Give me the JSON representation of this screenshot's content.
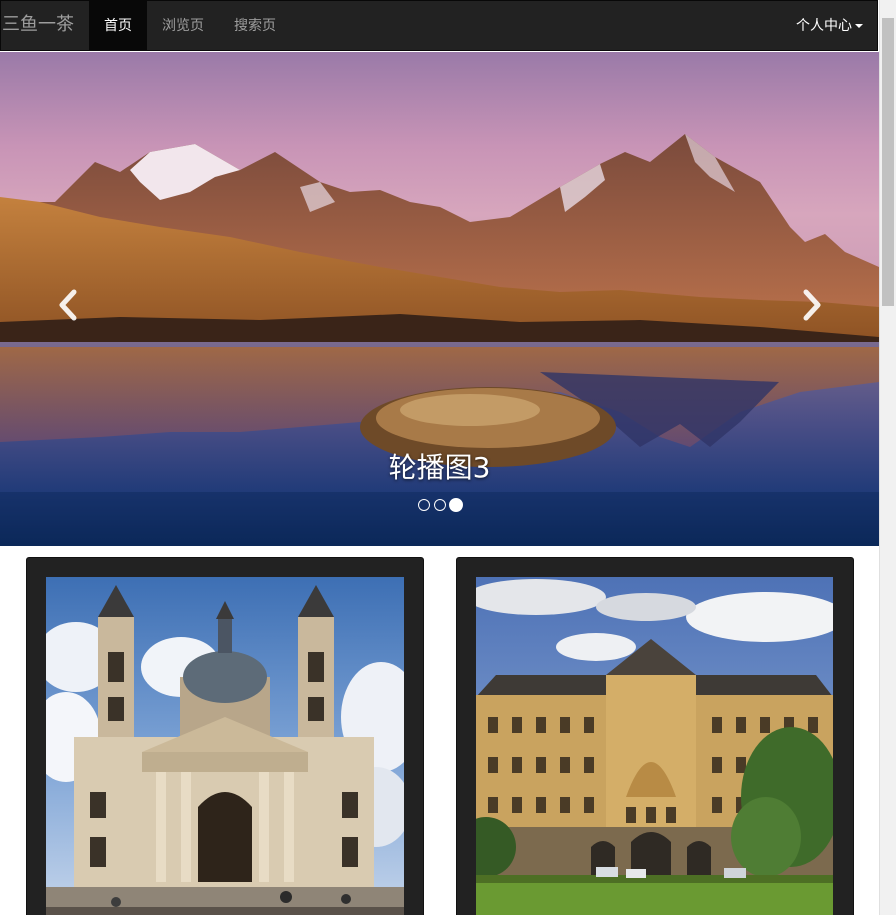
{
  "navbar": {
    "brand": "三鱼一茶",
    "items": [
      {
        "label": "首页",
        "active": true
      },
      {
        "label": "浏览页",
        "active": false
      },
      {
        "label": "搜索页",
        "active": false
      }
    ],
    "user_menu": "个人中心"
  },
  "carousel": {
    "caption": "轮播图3",
    "indicator_count": 3,
    "active_index": 2,
    "prev_icon": "chevron-left-icon",
    "next_icon": "chevron-right-icon"
  },
  "gallery": {
    "cards": [
      {
        "image": "basilica-photo"
      },
      {
        "image": "palace-photo"
      }
    ]
  },
  "colors": {
    "navbar_bg": "#222222",
    "nav_active_bg": "#080808",
    "nav_text": "#9d9d9d",
    "card_bg": "#222222"
  }
}
